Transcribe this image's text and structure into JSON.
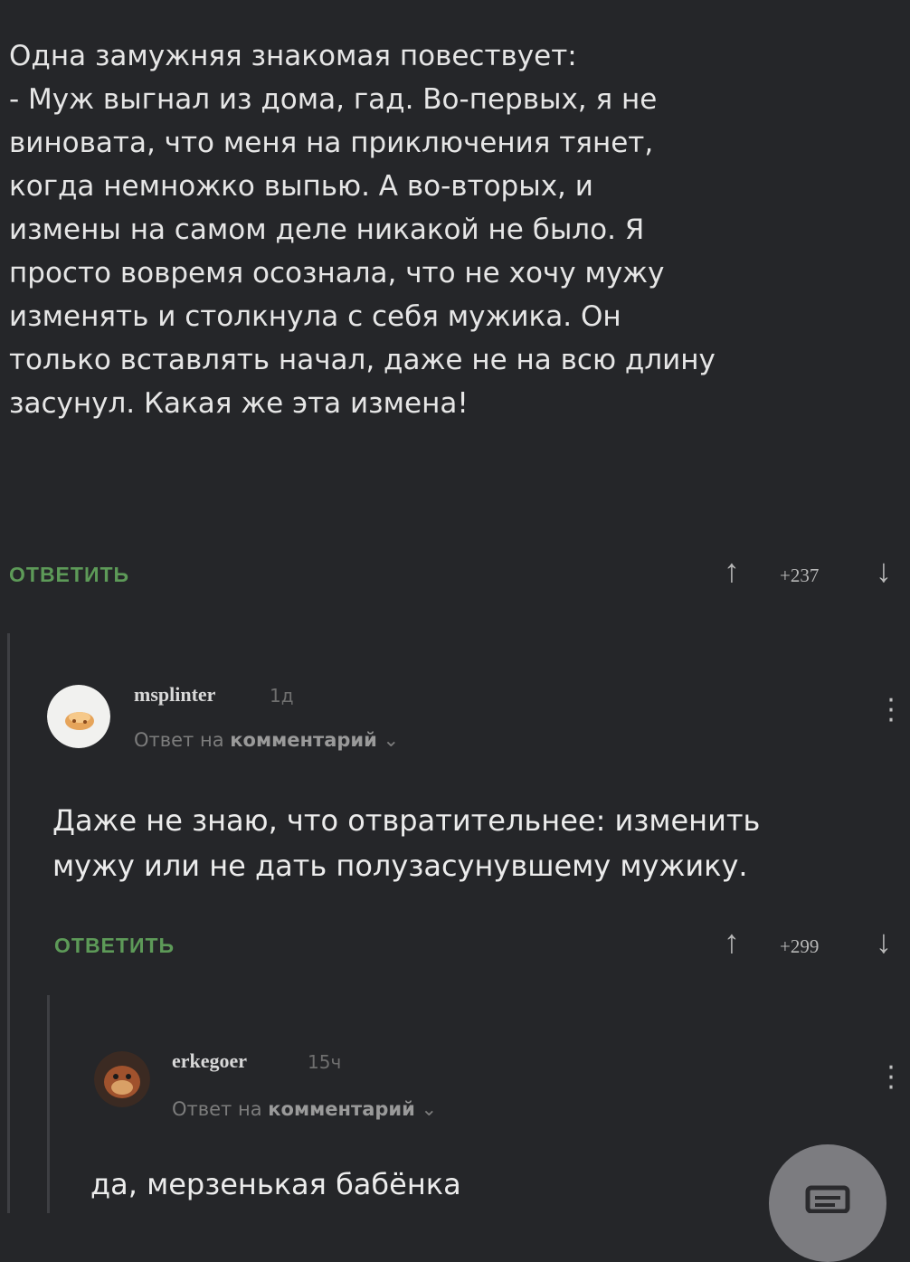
{
  "post": {
    "lines": [
      "Одна замужняя знакомая повествует:",
      "- Муж выгнал из дома, гад. Во-первых, я не",
      "виновата, что меня на приключения тянет,",
      "когда немножко выпью. А во-вторых, и",
      "измены на самом деле никакой не было. Я",
      "просто вовремя осознала, что не хочу мужу",
      "изменять и столкнула с себя мужика. Он",
      "только вставлять начал, даже не на всю длину",
      "засунул. Какая же эта измена!"
    ],
    "reply_label": "ОТВЕТИТЬ",
    "score": "+237"
  },
  "comments": [
    {
      "username": "msplinter",
      "time": "1д",
      "reply_prefix": "Ответ на",
      "reply_target": "комментарий",
      "chevron": "⌄",
      "lines": [
        "Даже не знаю, что отвратительнее: изменить",
        "мужу или не дать полузасунувшему мужику."
      ],
      "reply_label": "ОТВЕТИТЬ",
      "score": "+299"
    },
    {
      "username": "erkegoer",
      "time": "15ч",
      "reply_prefix": "Ответ на",
      "reply_target": "комментарий",
      "chevron": "⌄",
      "lines": [
        "да, мерзенькая бабёнка"
      ]
    }
  ],
  "icons": {
    "up_arrow": "↑",
    "down_arrow": "↓",
    "kebab": "more-vertical-icon",
    "fab": "comment-icon"
  },
  "colors": {
    "background": "#252629",
    "reply_green": "#5d9a58",
    "text": "#e6e6e6"
  }
}
